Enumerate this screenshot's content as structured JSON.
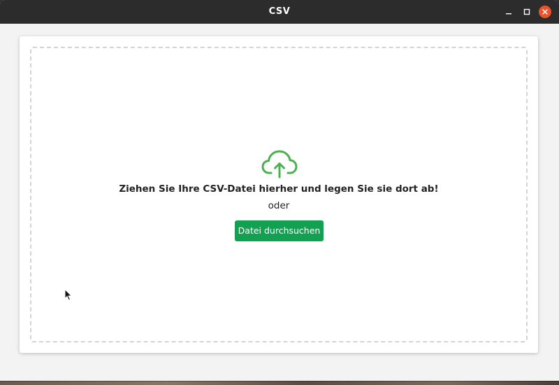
{
  "window": {
    "title": "CSV"
  },
  "dropzone": {
    "icon": "cloud-upload-icon",
    "instruction": "Ziehen Sie Ihre CSV-Datei hierher und legen Sie sie dort ab!",
    "separator": "oder",
    "browse_label": "Datei durchsuchen"
  },
  "colors": {
    "accent_green": "#12a150",
    "icon_green": "#4caf50",
    "titlebar": "#2c2c2c",
    "close_button": "#e9542b"
  }
}
